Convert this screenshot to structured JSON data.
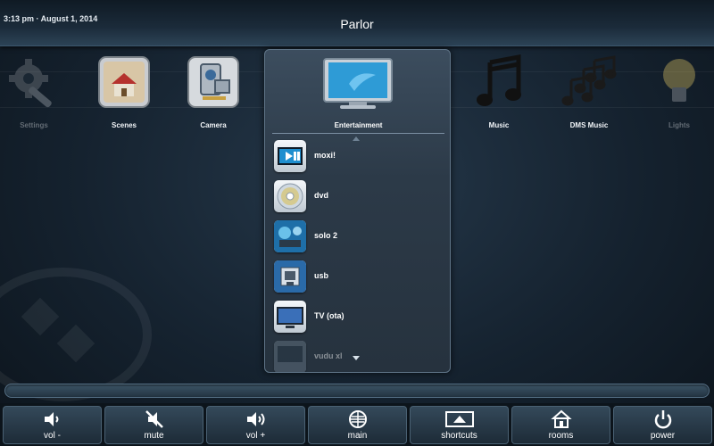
{
  "header": {
    "datetime": "3:13 pm · August 1, 2014",
    "room": "Parlor"
  },
  "apps": [
    {
      "label": "Settings",
      "icon": "gear-wrench-icon",
      "dim": true
    },
    {
      "label": "Scenes",
      "icon": "house-scene-icon",
      "dim": false
    },
    {
      "label": "Camera",
      "icon": "camera-icon",
      "dim": false
    },
    {
      "label": "Music",
      "icon": "music-note-icon",
      "dim": false
    },
    {
      "label": "DMS Music",
      "icon": "dms-music-icon",
      "dim": false
    },
    {
      "label": "Lights",
      "icon": "lightbulb-icon",
      "dim": true
    }
  ],
  "entertainment": {
    "title": "Entertainment",
    "icon": "tv-display-icon",
    "sources": [
      {
        "name": "moxi!",
        "icon": "moxi-icon"
      },
      {
        "name": "dvd",
        "icon": "dvd-disc-icon"
      },
      {
        "name": "solo 2",
        "icon": "solo-icon"
      },
      {
        "name": "usb",
        "icon": "usb-icon"
      },
      {
        "name": "TV (ota)",
        "icon": "tv-icon"
      },
      {
        "name": "vudu xl",
        "icon": "vudu-icon"
      }
    ]
  },
  "bottombar": [
    {
      "label": "vol -",
      "icon": "volume-down-icon"
    },
    {
      "label": "mute",
      "icon": "mute-icon"
    },
    {
      "label": "vol +",
      "icon": "volume-up-icon"
    },
    {
      "label": "main",
      "icon": "main-menu-icon"
    },
    {
      "label": "shortcuts",
      "icon": "shortcuts-icon"
    },
    {
      "label": "rooms",
      "icon": "rooms-icon"
    },
    {
      "label": "power",
      "icon": "power-icon"
    }
  ],
  "colors": {
    "accent": "#2e9bd6",
    "background": "#15222f",
    "text": "#ffffff"
  }
}
